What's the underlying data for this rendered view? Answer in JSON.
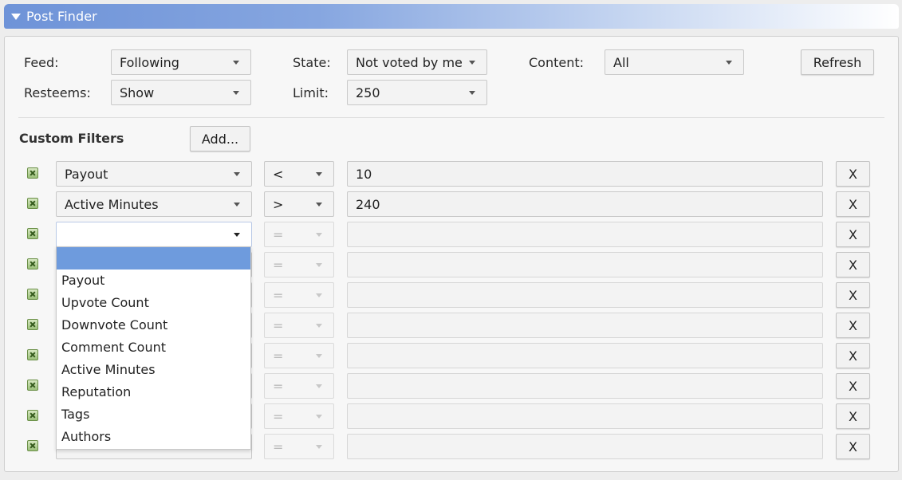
{
  "window": {
    "title": "Post Finder"
  },
  "settings": {
    "feed": {
      "label": "Feed:",
      "value": "Following"
    },
    "state": {
      "label": "State:",
      "value": "Not voted by me"
    },
    "content": {
      "label": "Content:",
      "value": "All"
    },
    "resteems": {
      "label": "Resteems:",
      "value": "Show"
    },
    "limit": {
      "label": "Limit:",
      "value": "250"
    },
    "refresh_label": "Refresh"
  },
  "custom_filters": {
    "heading": "Custom Filters",
    "add_label": "Add...",
    "remove_label": "X",
    "rows": [
      {
        "field": "Payout",
        "op": "<",
        "value": "10"
      },
      {
        "field": "Active Minutes",
        "op": ">",
        "value": "240"
      },
      {
        "field": "",
        "op": "=",
        "value": ""
      },
      {
        "field": "",
        "op": "=",
        "value": ""
      },
      {
        "field": "",
        "op": "=",
        "value": ""
      },
      {
        "field": "",
        "op": "=",
        "value": ""
      },
      {
        "field": "",
        "op": "=",
        "value": ""
      },
      {
        "field": "",
        "op": "=",
        "value": ""
      },
      {
        "field": "",
        "op": "=",
        "value": ""
      },
      {
        "field": "",
        "op": "=",
        "value": ""
      }
    ]
  },
  "field_dropdown": {
    "options": [
      "",
      "Payout",
      "Upvote Count",
      "Downvote Count",
      "Comment Count",
      "Active Minutes",
      "Reputation",
      "Tags",
      "Authors"
    ],
    "highlighted": 0
  },
  "colors": {
    "title_gradient_start": "#6e93d8",
    "highlight": "#6e9bdd"
  }
}
